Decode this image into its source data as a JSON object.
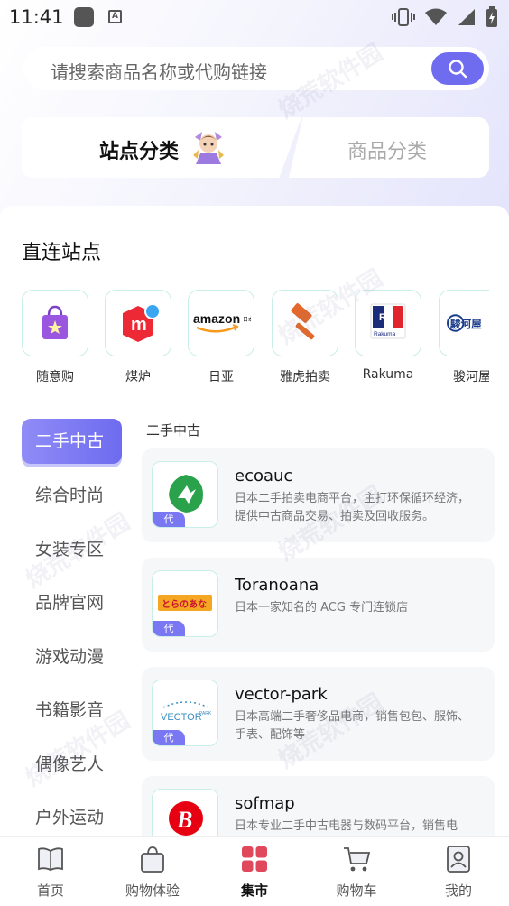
{
  "status_bar": {
    "time": "11:41"
  },
  "search": {
    "placeholder": "请搜索商品名称或代购链接"
  },
  "tabs": [
    {
      "label": "站点分类",
      "active": true
    },
    {
      "label": "商品分类",
      "active": false
    }
  ],
  "direct_sites": {
    "title": "直连站点",
    "items": [
      {
        "label": "随意购",
        "icon": "gift-bag-icon"
      },
      {
        "label": "煤炉",
        "icon": "mercari-icon"
      },
      {
        "label": "日亚",
        "icon": "amazon-jp-icon",
        "logo_text": "amazon",
        "logo_sub": "日本"
      },
      {
        "label": "雅虎拍卖",
        "icon": "auction-hammer-icon"
      },
      {
        "label": "Rakuma",
        "icon": "rakuma-icon",
        "logo_text": "Rakuma"
      },
      {
        "label": "骏河屋",
        "icon": "surugaya-icon",
        "logo_text": "駿河屋"
      }
    ]
  },
  "categories": [
    {
      "label": "二手中古",
      "active": true
    },
    {
      "label": "综合时尚"
    },
    {
      "label": "女装专区"
    },
    {
      "label": "品牌官网"
    },
    {
      "label": "游戏动漫"
    },
    {
      "label": "书籍影音"
    },
    {
      "label": "偶像艺人"
    },
    {
      "label": "户外运动"
    }
  ],
  "content": {
    "section_title": "二手中古",
    "shops": [
      {
        "name": "ecoauc",
        "badge": "代",
        "desc": "日本二手拍卖电商平台，主打环保循环经济，提供中古商品交易、拍卖及回收服务。"
      },
      {
        "name": "Toranoana",
        "badge": "代",
        "desc": "日本一家知名的 ACG 专门连锁店",
        "logo_text": "とらのあな"
      },
      {
        "name": "vector-park",
        "badge": "代",
        "desc": "日本高端二手奢侈品电商，销售包包、服饰、手表、配饰等",
        "logo_text": "VECTOR",
        "logo_sub": "PARK"
      },
      {
        "name": "sofmap",
        "badge": "代",
        "desc": "日本专业二手中古电器与数码平台，销售电脑、手机等"
      }
    ]
  },
  "bottom_nav": [
    {
      "label": "首页",
      "icon": "book-icon"
    },
    {
      "label": "购物体验",
      "icon": "shopping-bag-icon"
    },
    {
      "label": "集市",
      "icon": "grid-icon",
      "active": true
    },
    {
      "label": "购物车",
      "icon": "cart-icon"
    },
    {
      "label": "我的",
      "icon": "profile-icon"
    }
  ],
  "watermark": "烧荒软件园",
  "colors": {
    "accent": "#6f6cf0",
    "accent_light": "#8f8cf7"
  }
}
